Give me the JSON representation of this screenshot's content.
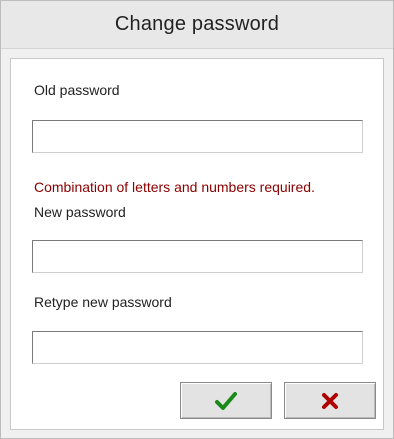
{
  "dialog": {
    "title": "Change password"
  },
  "form": {
    "old_password_label": "Old password",
    "old_password_value": "",
    "hint": "Combination of letters and numbers required.",
    "new_password_label": "New password",
    "new_password_value": "",
    "retype_password_label": "Retype new password",
    "retype_password_value": ""
  },
  "buttons": {
    "ok_icon": "checkmark-icon",
    "cancel_icon": "close-icon",
    "colors": {
      "ok": "#1a8a1a",
      "cancel": "#b00000"
    }
  }
}
